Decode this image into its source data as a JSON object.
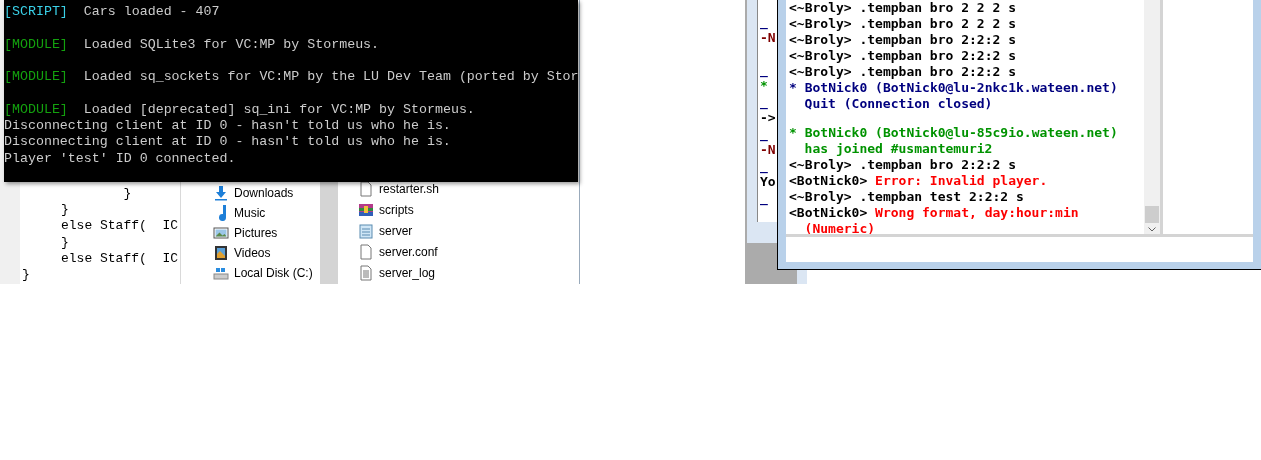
{
  "console": {
    "lines": [
      {
        "kind": "script",
        "tag": "[SCRIPT]",
        "text": "Cars loaded - 407"
      },
      {
        "kind": "module",
        "tag": "[MODULE]",
        "text": "Loaded SQLite3 for VC:MP by Stormeus."
      },
      {
        "kind": "module",
        "tag": "[MODULE]",
        "text": "Loaded sq_sockets for VC:MP by the LU Dev Team (ported by Stor"
      },
      {
        "kind": "module",
        "tag": "[MODULE]",
        "text": "Loaded [deprecated] sq_ini for VC:MP by Stormeus."
      },
      {
        "kind": "plain",
        "text": "Disconnecting client at ID 0 - hasn't told us who he is."
      },
      {
        "kind": "plain",
        "text": "Disconnecting client at ID 0 - hasn't told us who he is."
      },
      {
        "kind": "plain",
        "text": "Player 'test' ID 0 connected."
      }
    ]
  },
  "editor": {
    "lines": [
      "             }",
      "     }",
      "     else Staff(  IC",
      "     }",
      "     else Staff(  IC",
      "}"
    ]
  },
  "explorer": {
    "nav_items": [
      {
        "kind": "download",
        "label": "Downloads"
      },
      {
        "kind": "music",
        "label": "Music"
      },
      {
        "kind": "picture",
        "label": "Pictures"
      },
      {
        "kind": "video",
        "label": "Videos"
      },
      {
        "kind": "drive",
        "label": "Local Disk (C:)"
      }
    ],
    "files": [
      {
        "kind": "file",
        "label": "restarter.sh"
      },
      {
        "kind": "archive",
        "label": "scripts"
      },
      {
        "kind": "notepad",
        "label": "server"
      },
      {
        "kind": "file",
        "label": "server.conf"
      },
      {
        "kind": "text",
        "label": "server_log"
      }
    ]
  },
  "back_chat": {
    "lines": [
      {
        "kind": "part",
        "text": "_"
      },
      {
        "kind": "notice",
        "text": "-N"
      },
      {
        "kind": "blank"
      },
      {
        "kind": "part",
        "text": "_"
      },
      {
        "kind": "action",
        "text": "*"
      },
      {
        "kind": "part",
        "text": "_"
      },
      {
        "kind": "plain",
        "text": "->"
      },
      {
        "kind": "part",
        "text": "_"
      },
      {
        "kind": "notice",
        "text": "-N"
      },
      {
        "kind": "part",
        "text": "_"
      },
      {
        "kind": "plain",
        "text": "Yo"
      },
      {
        "kind": "part",
        "text": "_"
      }
    ]
  },
  "chat": {
    "lines": [
      {
        "kind": "message",
        "nick": "<~Broly>",
        "text": ".tempban bro 2 2 2 s"
      },
      {
        "kind": "message",
        "nick": "<~Broly>",
        "text": ".tempban bro 2 2 2 s"
      },
      {
        "kind": "message",
        "nick": "<~Broly>",
        "text": ".tempban bro 2:2:2 s"
      },
      {
        "kind": "message",
        "nick": "<~Broly>",
        "text": ".tempban bro 2:2:2 s"
      },
      {
        "kind": "message",
        "nick": "<~Broly>",
        "text": ".tempban bro 2:2:2 s"
      },
      {
        "kind": "quit",
        "text": "* BotNick0 (BotNick0@lu-2nkc1k.wateen.net)",
        "detail": "Quit (Connection closed)"
      },
      {
        "kind": "marker"
      },
      {
        "kind": "join",
        "text": "* BotNick0 (BotNick0@lu-85c9io.wateen.net)",
        "detail": "has joined #usmantemuri2"
      },
      {
        "kind": "message",
        "nick": "<~Broly>",
        "text": ".tempban bro 2:2:2 s"
      },
      {
        "kind": "error",
        "nick": "<BotNick0>",
        "text": "Error: Invalid player."
      },
      {
        "kind": "message",
        "nick": "<~Broly>",
        "text": ".tempban test 2:2:2 s"
      },
      {
        "kind": "error",
        "nick": "<BotNick0>",
        "text": "Wrong format, day:hour:min",
        "detail": "(Numeric)"
      }
    ]
  }
}
